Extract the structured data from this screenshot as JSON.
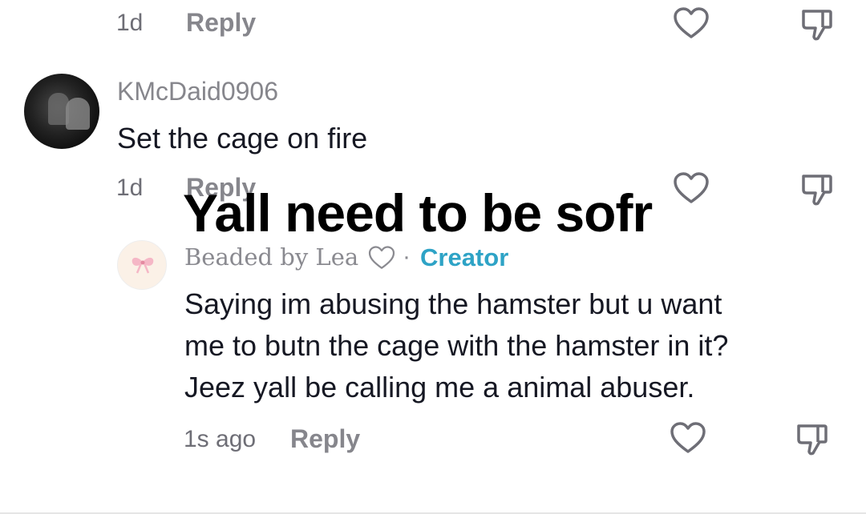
{
  "comments": [
    {
      "time": "1d",
      "reply_label": "Reply"
    },
    {
      "username": "KMcDaid0906",
      "text": "Set the cage on fire",
      "time": "1d",
      "reply_label": "Reply"
    },
    {
      "username": "Beaded by Lea",
      "separator": "·",
      "badge": "Creator",
      "text_lines": [
        "Saying im abusing the hamster but u want",
        "me to butn the cage with the hamster in it?",
        "Jeez yall be calling me a animal abuser."
      ],
      "time": "1s ago",
      "reply_label": "Reply"
    }
  ],
  "overlay_caption": "Yall need to be sofr",
  "icons": {
    "like": "heart-outline-icon",
    "dislike": "thumbs-down-icon",
    "username_heart": "heart-outline-icon"
  },
  "colors": {
    "creator": "#2ea3c6",
    "muted_text": "#86868c",
    "primary_text": "#161823"
  }
}
